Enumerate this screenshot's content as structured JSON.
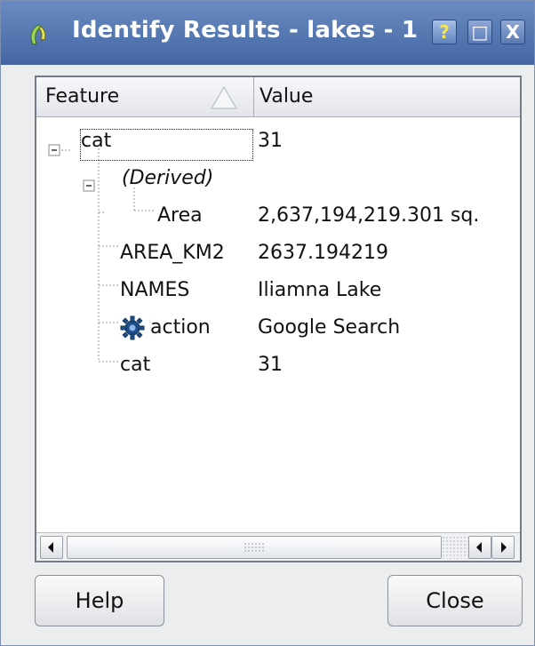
{
  "window": {
    "title": "Identify Results - lakes - 1",
    "buttons": {
      "help": "?",
      "maximize": "□",
      "close": "X"
    }
  },
  "tree": {
    "columns": [
      "Feature",
      "Value"
    ],
    "rows": [
      {
        "feature": "cat",
        "value": "31"
      },
      {
        "feature": "(Derived)",
        "value": ""
      },
      {
        "feature": "Area",
        "value": "2,637,194,219.301 sq."
      },
      {
        "feature": "AREA_KM2",
        "value": "2637.194219"
      },
      {
        "feature": "NAMES",
        "value": "Iliamna Lake"
      },
      {
        "feature": "action",
        "value": "Google Search"
      },
      {
        "feature": "cat",
        "value": "31"
      }
    ]
  },
  "footer": {
    "help": "Help",
    "close": "Close"
  },
  "colors": {
    "titlebar": "#4f72ad",
    "accent": "#f7e64a"
  },
  "icons": [
    "qgis-logo-icon",
    "gear-icon",
    "sort-ascending-icon",
    "expand-minus-icon"
  ]
}
